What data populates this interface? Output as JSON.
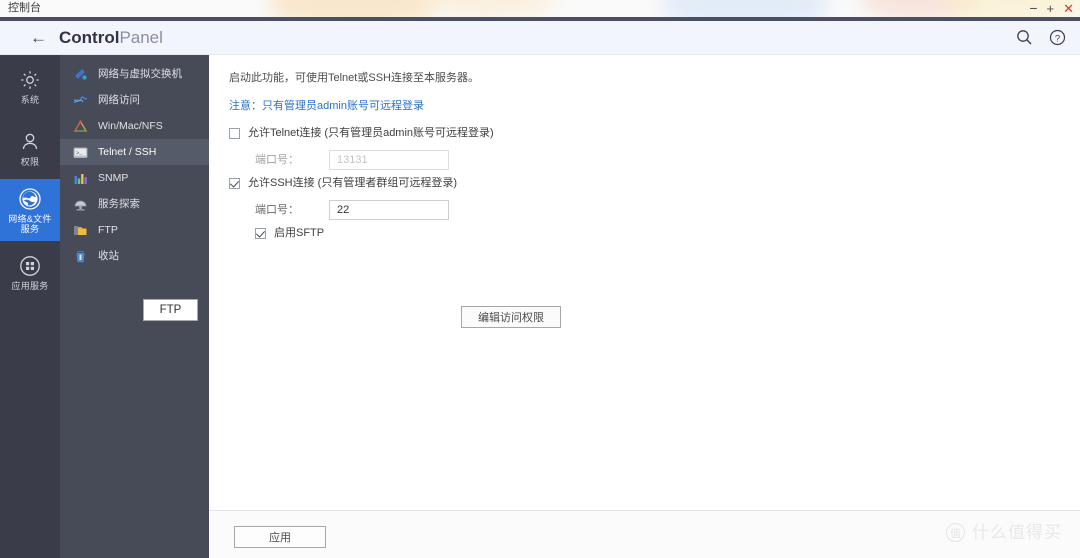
{
  "window": {
    "title": "控制台",
    "controls": {
      "minimize": "−",
      "maximize": "+",
      "close": "✕"
    }
  },
  "header": {
    "back_icon": "←",
    "title_bold": "Control",
    "title_light": "Panel",
    "search_icon": "search-icon",
    "help_icon": "help-icon"
  },
  "rail": {
    "items": [
      {
        "label": "系统",
        "icon": "gear-icon",
        "active": false
      },
      {
        "label": "权限",
        "icon": "user-icon",
        "active": false
      },
      {
        "label": "网络&文件\n服务",
        "icon": "globe-icon",
        "active": true
      },
      {
        "label": "应用服务",
        "icon": "grid-icon",
        "active": false
      }
    ]
  },
  "sidebar": {
    "items": [
      {
        "label": "网络与虚拟交换机",
        "icon": "network-switch-icon",
        "selected": false
      },
      {
        "label": "网络访问",
        "icon": "network-access-icon",
        "selected": false
      },
      {
        "label": "Win/Mac/NFS",
        "icon": "triangle-icon",
        "selected": false
      },
      {
        "label": "Telnet / SSH",
        "icon": "terminal-icon",
        "selected": true
      },
      {
        "label": "SNMP",
        "icon": "bar-chart-icon",
        "selected": false
      },
      {
        "label": "服务探索",
        "icon": "dome-icon",
        "selected": false
      },
      {
        "label": "FTP",
        "icon": "folder-icon",
        "selected": false
      },
      {
        "label": "收站",
        "icon": "recycle-bin-icon",
        "selected": false
      }
    ],
    "tooltip": "FTP"
  },
  "main": {
    "intro": "启动此功能，可使用Telnet或SSH连接至本服务器。",
    "note": "注意：只有管理员admin账号可远程登录",
    "telnet": {
      "checkbox_label": "允许Telnet连接 (只有管理员admin账号可远程登录)",
      "checked": false,
      "port_label": "端口号：",
      "port_value": "13131",
      "port_disabled": true
    },
    "ssh": {
      "checkbox_label": "允许SSH连接 (只有管理者群组可远程登录)",
      "checked": true,
      "port_label": "端口号：",
      "port_value": "22",
      "sftp_label": "启用SFTP",
      "sftp_checked": true
    },
    "edit_permission_button": "编辑访问权限"
  },
  "footer": {
    "apply_button": "应用",
    "watermark_mark": "值",
    "watermark_text": "什么值得买"
  },
  "colors": {
    "accent_blue": "#2f72d8",
    "rail_bg": "#3a3d49",
    "sidebar_bg": "#474b57",
    "note_blue": "#2b71c8",
    "close_red": "#e8342b"
  }
}
